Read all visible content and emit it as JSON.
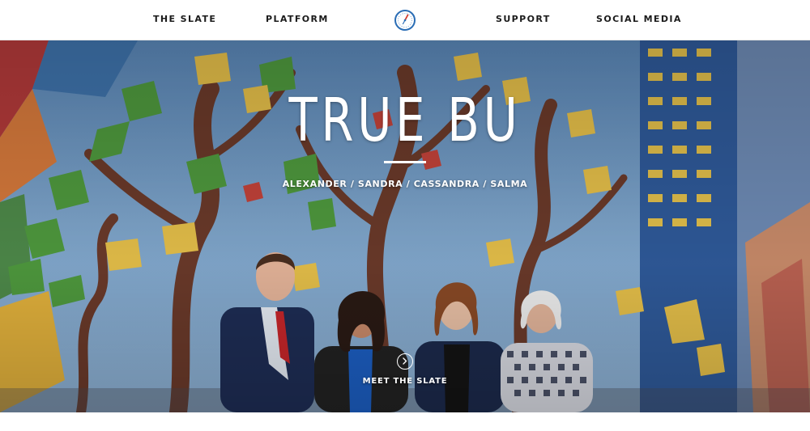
{
  "nav": {
    "items": [
      {
        "label": "THE SLATE"
      },
      {
        "label": "PLATFORM"
      },
      {
        "label": "SUPPORT"
      },
      {
        "label": "SOCIAL MEDIA"
      }
    ],
    "logo_icon": "compass-icon"
  },
  "hero": {
    "title": "TRUE BU",
    "names": "ALEXANDER / SANDRA / CASSANDRA / SALMA",
    "cta_icon": "chevron-right-circle-icon",
    "cta_label": "MEET THE SLATE"
  },
  "colors": {
    "nav_bg": "#ffffff",
    "nav_text": "#1b1b1b",
    "logo_blue": "#2a6db5",
    "logo_red": "#d33b2c",
    "hero_text": "#ffffff"
  }
}
